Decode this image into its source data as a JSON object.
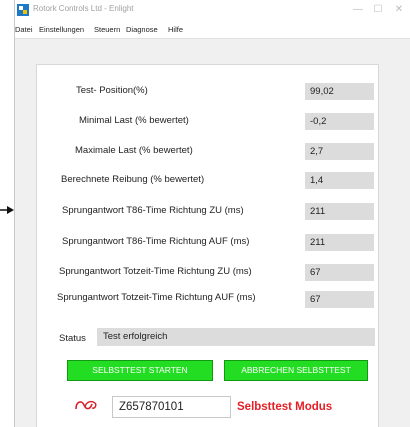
{
  "window": {
    "title": "Rotork Controls Ltd - Enlight",
    "controls": {
      "minimize": "—",
      "maximize": "☐",
      "close": "✕"
    }
  },
  "menu": [
    "Datei",
    "Einstellungen",
    "Steuern",
    "Diagnose",
    "Hilfe"
  ],
  "rows": [
    {
      "label": "Test- Position(%)",
      "value": "99,02"
    },
    {
      "label": "Minimal Last (% bewertet)",
      "value": "-0,2"
    },
    {
      "label": "Maximale Last (% bewertet)",
      "value": "2,7"
    },
    {
      "label": "Berechnete Reibung (% bewertet)",
      "value": "1,4"
    },
    {
      "label": "Sprungantwort T86-Time Richtung ZU (ms)",
      "value": "211"
    },
    {
      "label": "Sprungantwort T86-Time Richtung AUF (ms)",
      "value": "211"
    },
    {
      "label": "Sprungantwort Totzeit-Time Richtung ZU (ms)",
      "value": "67"
    },
    {
      "label": "Sprungantwort Totzeit-Time Richtung AUF (ms)",
      "value": "67"
    }
  ],
  "status": {
    "label": "Status",
    "value": "Test erfolgreich"
  },
  "buttons": {
    "start": "SELBSTTEST STARTEN",
    "abort": "ABBRECHEN SELBSTTEST"
  },
  "footer": {
    "serial": "Z657870101",
    "mode": "Selbsttest Modus"
  },
  "icons": {
    "app": "enlight-app-icon",
    "logo": "rotork-logo-icon",
    "pointer": "arrow-pointer-icon"
  },
  "colors": {
    "button_green": "#22dd22",
    "mode_red": "#e41f26",
    "field_gray": "#dcdcdc"
  }
}
